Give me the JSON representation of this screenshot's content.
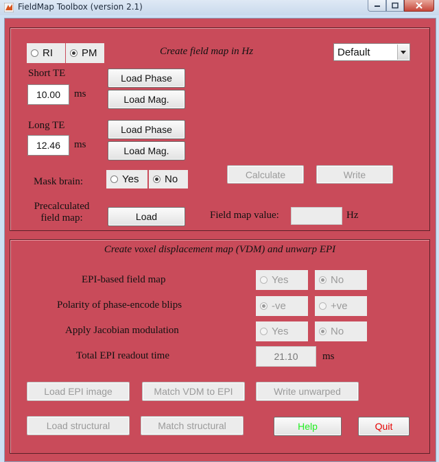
{
  "window": {
    "title": "FieldMap Toolbox (version 2.1)"
  },
  "fieldmap": {
    "heading": "Create field map in Hz",
    "mode_options": {
      "ri": "RI",
      "pm": "PM",
      "selected": "PM"
    },
    "preset": {
      "value": "Default"
    },
    "short_te": {
      "label": "Short TE",
      "value": "10.00",
      "unit": "ms",
      "load_phase": "Load Phase",
      "load_mag": "Load Mag."
    },
    "long_te": {
      "label": "Long TE",
      "value": "12.46",
      "unit": "ms",
      "load_phase": "Load Phase",
      "load_mag": "Load Mag."
    },
    "mask_brain": {
      "label": "Mask brain:",
      "yes": "Yes",
      "no": "No",
      "selected": "No"
    },
    "calculate": "Calculate",
    "write": "Write",
    "precalculated": {
      "label_line1": "Precalculated",
      "label_line2": "field map:",
      "load": "Load"
    },
    "field_map_value": {
      "label": "Field map value:",
      "value": "",
      "unit": "Hz"
    }
  },
  "vdm": {
    "heading": "Create voxel displacement map (VDM) and unwarp EPI",
    "epi_based": {
      "label": "EPI-based field map",
      "yes": "Yes",
      "no": "No",
      "selected": "No"
    },
    "polarity": {
      "label": "Polarity of phase-encode blips",
      "neg": "-ve",
      "pos": "+ve",
      "selected": "-ve"
    },
    "jacobian": {
      "label": "Apply Jacobian modulation",
      "yes": "Yes",
      "no": "No",
      "selected": "No"
    },
    "readout": {
      "label": "Total EPI readout time",
      "value": "21.10",
      "unit": "ms"
    },
    "buttons": {
      "load_epi": "Load EPI image",
      "match_vdm": "Match VDM to EPI",
      "write_unwarped": "Write unwarped",
      "load_structural": "Load structural",
      "match_structural": "Match structural",
      "help": "Help",
      "quit": "Quit"
    }
  },
  "colors": {
    "background": "#c94b5a",
    "help_text": "#22ee22",
    "quit_text": "#e60000"
  }
}
